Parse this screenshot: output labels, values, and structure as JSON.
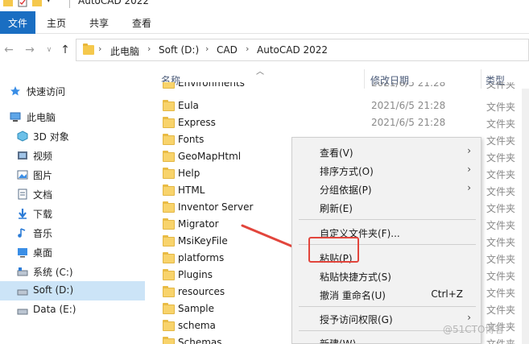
{
  "window": {
    "title": "AutoCAD 2022"
  },
  "ribbon": {
    "tabs": [
      "文件",
      "主页",
      "共享",
      "查看"
    ]
  },
  "address": {
    "crumbs": [
      "此电脑",
      "Soft (D:)",
      "CAD",
      "AutoCAD 2022"
    ]
  },
  "navpane": {
    "quick_access": "快速访问",
    "this_pc": "此电脑",
    "items": [
      {
        "label": "3D 对象",
        "icon": "3d-objects-icon"
      },
      {
        "label": "视频",
        "icon": "video-icon"
      },
      {
        "label": "图片",
        "icon": "pictures-icon"
      },
      {
        "label": "文档",
        "icon": "documents-icon"
      },
      {
        "label": "下载",
        "icon": "download-icon"
      },
      {
        "label": "音乐",
        "icon": "music-icon"
      },
      {
        "label": "桌面",
        "icon": "desktop-icon"
      },
      {
        "label": "系统 (C:)",
        "icon": "drive-icon"
      },
      {
        "label": "Soft (D:)",
        "icon": "drive-icon"
      },
      {
        "label": "Data (E:)",
        "icon": "drive-icon"
      }
    ]
  },
  "columns": {
    "name": "名称",
    "modified": "修改日期",
    "type": "类型"
  },
  "files": [
    {
      "name": "Environments",
      "date": "2021/6/5 21:28",
      "type": "文件夹"
    },
    {
      "name": "Eula",
      "date": "2021/6/5 21:28",
      "type": "文件夹"
    },
    {
      "name": "Express",
      "date": "2021/6/5 21:28",
      "type": "文件夹"
    },
    {
      "name": "Fonts",
      "date": "",
      "type": "文件夹"
    },
    {
      "name": "GeoMapHtml",
      "date": "",
      "type": "文件夹"
    },
    {
      "name": "Help",
      "date": "",
      "type": "文件夹"
    },
    {
      "name": "HTML",
      "date": "",
      "type": "文件夹"
    },
    {
      "name": "Inventor Server",
      "date": "",
      "type": "文件夹"
    },
    {
      "name": "Migrator",
      "date": "",
      "type": "文件夹"
    },
    {
      "name": "MsiKeyFile",
      "date": "",
      "type": "文件夹"
    },
    {
      "name": "platforms",
      "date": "",
      "type": "文件夹"
    },
    {
      "name": "Plugins",
      "date": "",
      "type": "文件夹"
    },
    {
      "name": "resources",
      "date": "",
      "type": "文件夹"
    },
    {
      "name": "Sample",
      "date": "",
      "type": "文件夹"
    },
    {
      "name": "schema",
      "date": "",
      "type": "文件夹"
    },
    {
      "name": "Schemas",
      "date": "",
      "type": "文件夹"
    }
  ],
  "context_menu": {
    "view": "查看(V)",
    "sort": "排序方式(O)",
    "group": "分组依据(P)",
    "refresh": "刷新(E)",
    "customize": "自定义文件夹(F)...",
    "paste": "粘贴(P)",
    "paste_shortcut": "粘贴快捷方式(S)",
    "undo": "撤消 重命名(U)",
    "undo_shortcut": "Ctrl+Z",
    "grant_access": "授予访问权限(G)",
    "new": "新建(W)"
  },
  "watermark": "@51CTO博客",
  "colors": {
    "accent": "#1a6ec2",
    "highlight": "#e2453c",
    "folder": "#f8d36b",
    "selected": "#cce4f7"
  }
}
